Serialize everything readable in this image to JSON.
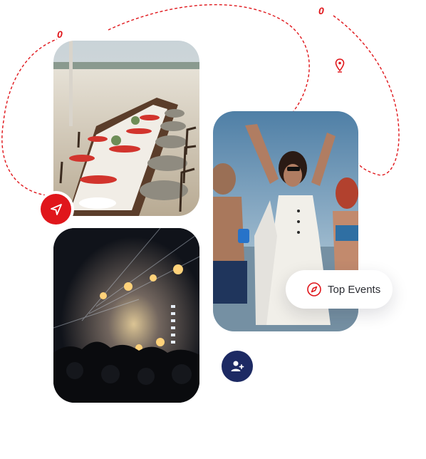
{
  "route_markers": [
    "0",
    "0"
  ],
  "badge": {
    "label": "Top Events",
    "icon": "compass-icon"
  },
  "buttons": {
    "send": "send-icon",
    "add_user": "add-user-icon"
  },
  "photos": [
    "beach-dinner-table",
    "beach-party-dancers",
    "concert-crowd-fireworks"
  ],
  "colors": {
    "accent": "#e0161b",
    "navy": "#1d2a63",
    "text": "#2b2d33"
  }
}
